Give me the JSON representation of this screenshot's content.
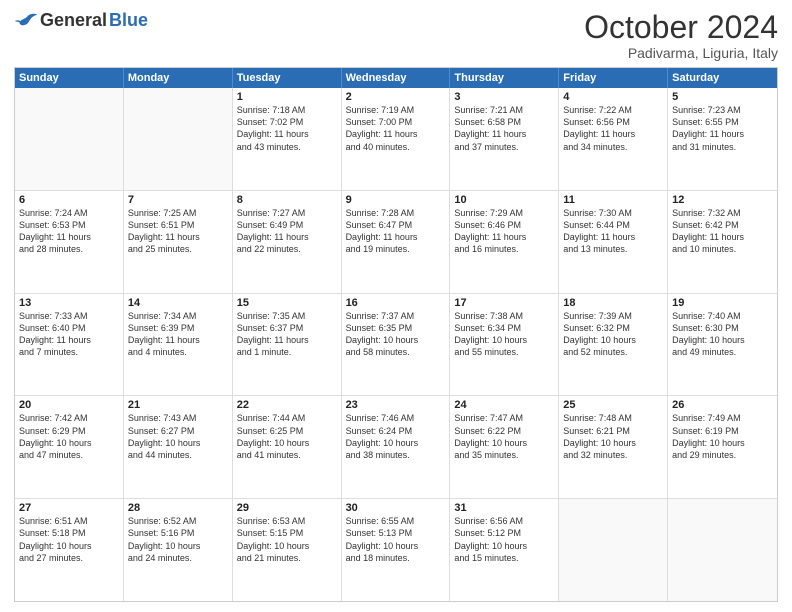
{
  "header": {
    "logo_general": "General",
    "logo_blue": "Blue",
    "month_title": "October 2024",
    "subtitle": "Padivarma, Liguria, Italy"
  },
  "days": [
    "Sunday",
    "Monday",
    "Tuesday",
    "Wednesday",
    "Thursday",
    "Friday",
    "Saturday"
  ],
  "rows": [
    [
      {
        "day": "",
        "lines": [],
        "empty": true
      },
      {
        "day": "",
        "lines": [],
        "empty": true
      },
      {
        "day": "1",
        "lines": [
          "Sunrise: 7:18 AM",
          "Sunset: 7:02 PM",
          "Daylight: 11 hours",
          "and 43 minutes."
        ],
        "empty": false
      },
      {
        "day": "2",
        "lines": [
          "Sunrise: 7:19 AM",
          "Sunset: 7:00 PM",
          "Daylight: 11 hours",
          "and 40 minutes."
        ],
        "empty": false
      },
      {
        "day": "3",
        "lines": [
          "Sunrise: 7:21 AM",
          "Sunset: 6:58 PM",
          "Daylight: 11 hours",
          "and 37 minutes."
        ],
        "empty": false
      },
      {
        "day": "4",
        "lines": [
          "Sunrise: 7:22 AM",
          "Sunset: 6:56 PM",
          "Daylight: 11 hours",
          "and 34 minutes."
        ],
        "empty": false
      },
      {
        "day": "5",
        "lines": [
          "Sunrise: 7:23 AM",
          "Sunset: 6:55 PM",
          "Daylight: 11 hours",
          "and 31 minutes."
        ],
        "empty": false
      }
    ],
    [
      {
        "day": "6",
        "lines": [
          "Sunrise: 7:24 AM",
          "Sunset: 6:53 PM",
          "Daylight: 11 hours",
          "and 28 minutes."
        ],
        "empty": false
      },
      {
        "day": "7",
        "lines": [
          "Sunrise: 7:25 AM",
          "Sunset: 6:51 PM",
          "Daylight: 11 hours",
          "and 25 minutes."
        ],
        "empty": false
      },
      {
        "day": "8",
        "lines": [
          "Sunrise: 7:27 AM",
          "Sunset: 6:49 PM",
          "Daylight: 11 hours",
          "and 22 minutes."
        ],
        "empty": false
      },
      {
        "day": "9",
        "lines": [
          "Sunrise: 7:28 AM",
          "Sunset: 6:47 PM",
          "Daylight: 11 hours",
          "and 19 minutes."
        ],
        "empty": false
      },
      {
        "day": "10",
        "lines": [
          "Sunrise: 7:29 AM",
          "Sunset: 6:46 PM",
          "Daylight: 11 hours",
          "and 16 minutes."
        ],
        "empty": false
      },
      {
        "day": "11",
        "lines": [
          "Sunrise: 7:30 AM",
          "Sunset: 6:44 PM",
          "Daylight: 11 hours",
          "and 13 minutes."
        ],
        "empty": false
      },
      {
        "day": "12",
        "lines": [
          "Sunrise: 7:32 AM",
          "Sunset: 6:42 PM",
          "Daylight: 11 hours",
          "and 10 minutes."
        ],
        "empty": false
      }
    ],
    [
      {
        "day": "13",
        "lines": [
          "Sunrise: 7:33 AM",
          "Sunset: 6:40 PM",
          "Daylight: 11 hours",
          "and 7 minutes."
        ],
        "empty": false
      },
      {
        "day": "14",
        "lines": [
          "Sunrise: 7:34 AM",
          "Sunset: 6:39 PM",
          "Daylight: 11 hours",
          "and 4 minutes."
        ],
        "empty": false
      },
      {
        "day": "15",
        "lines": [
          "Sunrise: 7:35 AM",
          "Sunset: 6:37 PM",
          "Daylight: 11 hours",
          "and 1 minute."
        ],
        "empty": false
      },
      {
        "day": "16",
        "lines": [
          "Sunrise: 7:37 AM",
          "Sunset: 6:35 PM",
          "Daylight: 10 hours",
          "and 58 minutes."
        ],
        "empty": false
      },
      {
        "day": "17",
        "lines": [
          "Sunrise: 7:38 AM",
          "Sunset: 6:34 PM",
          "Daylight: 10 hours",
          "and 55 minutes."
        ],
        "empty": false
      },
      {
        "day": "18",
        "lines": [
          "Sunrise: 7:39 AM",
          "Sunset: 6:32 PM",
          "Daylight: 10 hours",
          "and 52 minutes."
        ],
        "empty": false
      },
      {
        "day": "19",
        "lines": [
          "Sunrise: 7:40 AM",
          "Sunset: 6:30 PM",
          "Daylight: 10 hours",
          "and 49 minutes."
        ],
        "empty": false
      }
    ],
    [
      {
        "day": "20",
        "lines": [
          "Sunrise: 7:42 AM",
          "Sunset: 6:29 PM",
          "Daylight: 10 hours",
          "and 47 minutes."
        ],
        "empty": false
      },
      {
        "day": "21",
        "lines": [
          "Sunrise: 7:43 AM",
          "Sunset: 6:27 PM",
          "Daylight: 10 hours",
          "and 44 minutes."
        ],
        "empty": false
      },
      {
        "day": "22",
        "lines": [
          "Sunrise: 7:44 AM",
          "Sunset: 6:25 PM",
          "Daylight: 10 hours",
          "and 41 minutes."
        ],
        "empty": false
      },
      {
        "day": "23",
        "lines": [
          "Sunrise: 7:46 AM",
          "Sunset: 6:24 PM",
          "Daylight: 10 hours",
          "and 38 minutes."
        ],
        "empty": false
      },
      {
        "day": "24",
        "lines": [
          "Sunrise: 7:47 AM",
          "Sunset: 6:22 PM",
          "Daylight: 10 hours",
          "and 35 minutes."
        ],
        "empty": false
      },
      {
        "day": "25",
        "lines": [
          "Sunrise: 7:48 AM",
          "Sunset: 6:21 PM",
          "Daylight: 10 hours",
          "and 32 minutes."
        ],
        "empty": false
      },
      {
        "day": "26",
        "lines": [
          "Sunrise: 7:49 AM",
          "Sunset: 6:19 PM",
          "Daylight: 10 hours",
          "and 29 minutes."
        ],
        "empty": false
      }
    ],
    [
      {
        "day": "27",
        "lines": [
          "Sunrise: 6:51 AM",
          "Sunset: 5:18 PM",
          "Daylight: 10 hours",
          "and 27 minutes."
        ],
        "empty": false
      },
      {
        "day": "28",
        "lines": [
          "Sunrise: 6:52 AM",
          "Sunset: 5:16 PM",
          "Daylight: 10 hours",
          "and 24 minutes."
        ],
        "empty": false
      },
      {
        "day": "29",
        "lines": [
          "Sunrise: 6:53 AM",
          "Sunset: 5:15 PM",
          "Daylight: 10 hours",
          "and 21 minutes."
        ],
        "empty": false
      },
      {
        "day": "30",
        "lines": [
          "Sunrise: 6:55 AM",
          "Sunset: 5:13 PM",
          "Daylight: 10 hours",
          "and 18 minutes."
        ],
        "empty": false
      },
      {
        "day": "31",
        "lines": [
          "Sunrise: 6:56 AM",
          "Sunset: 5:12 PM",
          "Daylight: 10 hours",
          "and 15 minutes."
        ],
        "empty": false
      },
      {
        "day": "",
        "lines": [],
        "empty": true
      },
      {
        "day": "",
        "lines": [],
        "empty": true
      }
    ]
  ]
}
